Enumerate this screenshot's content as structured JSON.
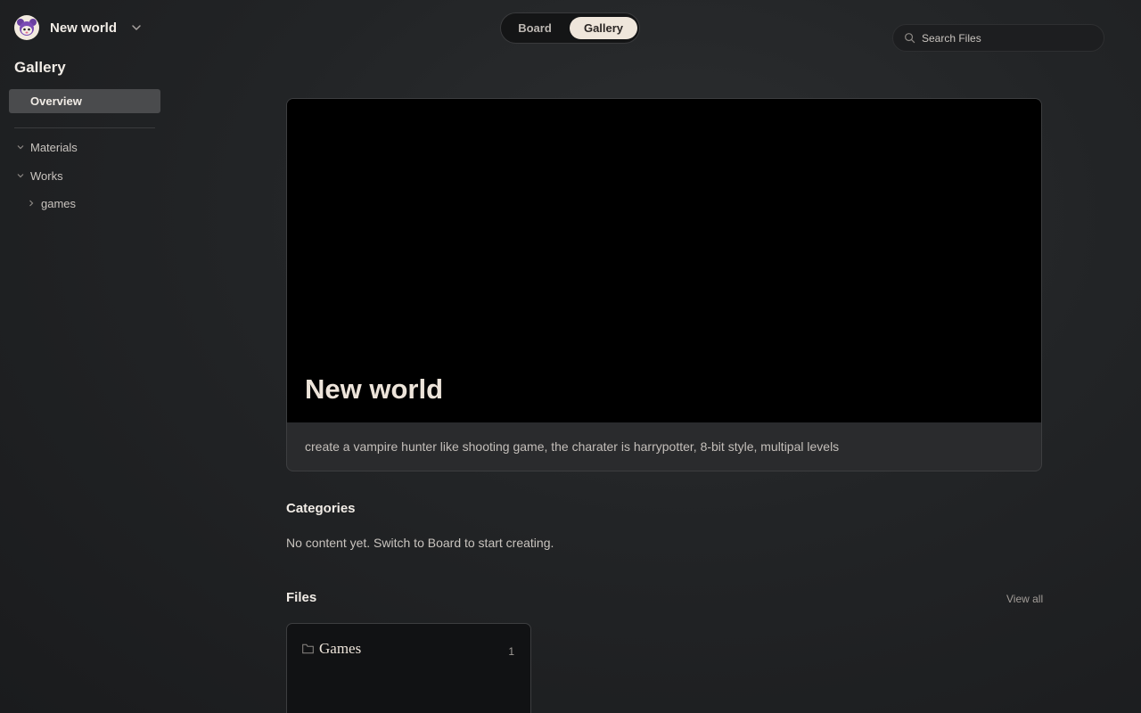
{
  "world": {
    "name": "New world"
  },
  "sidebar": {
    "title": "Gallery",
    "overview": "Overview",
    "tree": [
      {
        "label": "Materials"
      },
      {
        "label": "Works"
      },
      {
        "label": "games"
      }
    ]
  },
  "view_toggle": {
    "board": "Board",
    "gallery": "Gallery",
    "active": "Gallery"
  },
  "search": {
    "placeholder": "Search Files"
  },
  "hero": {
    "title": "New world",
    "description": "create a vampire hunter like shooting game, the charater is harrypotter, 8-bit style, multipal levels"
  },
  "categories": {
    "title": "Categories",
    "empty": "No content yet. Switch to Board to start creating."
  },
  "files": {
    "title": "Files",
    "view_all": "View all",
    "items": [
      {
        "name": "Games",
        "count": "1"
      }
    ]
  },
  "colors": {
    "accent": "#efe6db",
    "background": "#222426"
  }
}
